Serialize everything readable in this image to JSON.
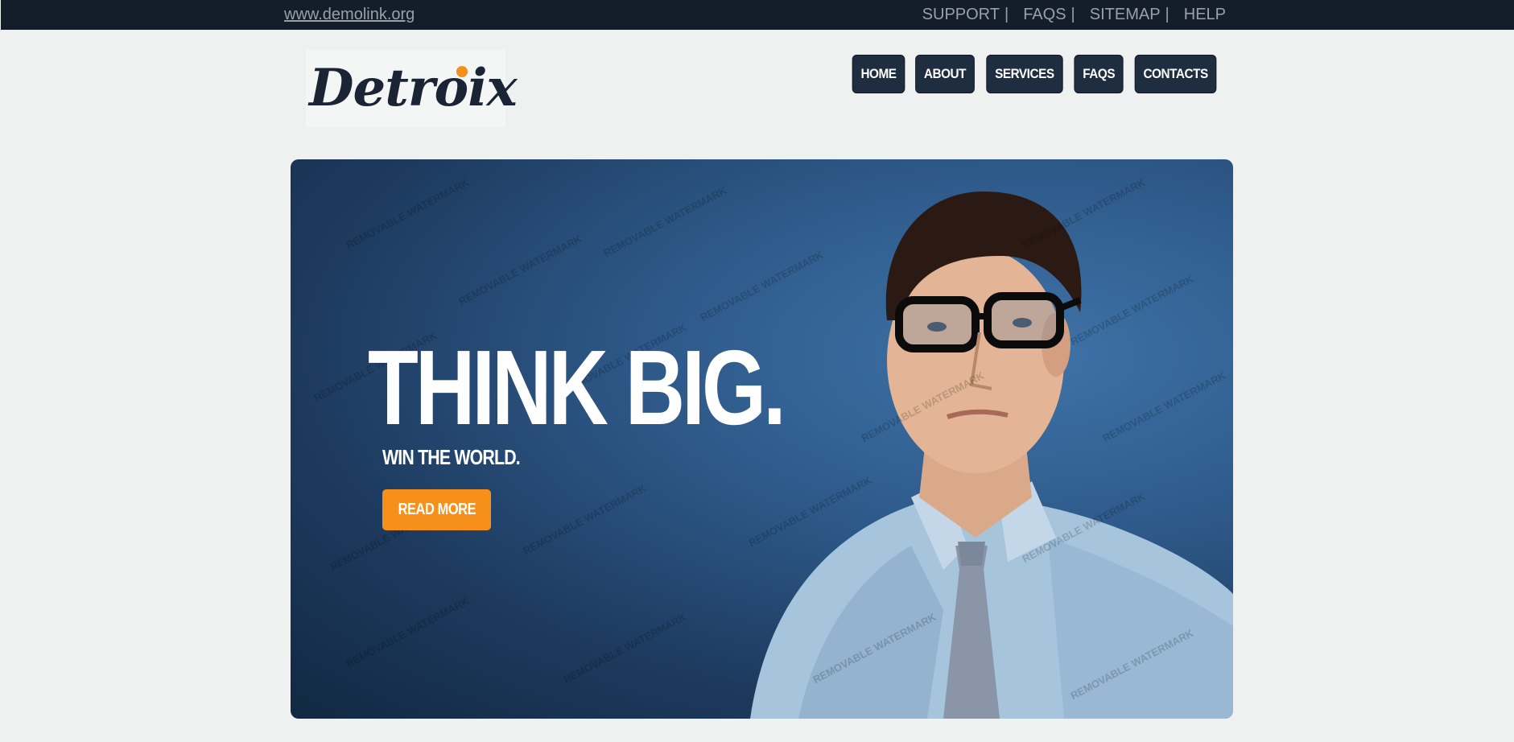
{
  "topbar": {
    "site_link": "www.demolink.org",
    "links": [
      "SUPPORT",
      "FAQS",
      "SITEMAP",
      "HELP"
    ],
    "separator": "|"
  },
  "logo": {
    "text": "Detroix"
  },
  "nav": {
    "items": [
      "HOME",
      "ABOUT",
      "SERVICES",
      "FAQS",
      "CONTACTS"
    ]
  },
  "banner": {
    "headline": "THINK BIG.",
    "subline": "WIN THE WORLD.",
    "button_label": "READ MORE",
    "watermark_text": "REMOVABLE WATERMARK"
  },
  "colors": {
    "topbar_bg": "#141d2a",
    "page_bg": "#eff1f0",
    "nav_bg": "#1f2d40",
    "accent": "#f6901a",
    "logo_text": "#1a2435"
  }
}
